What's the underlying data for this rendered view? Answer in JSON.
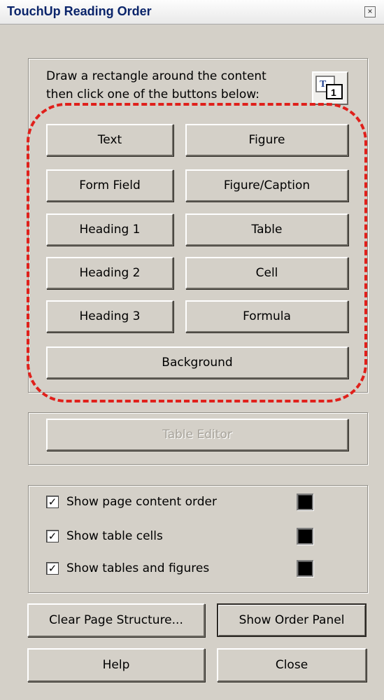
{
  "window": {
    "title": "TouchUp Reading Order",
    "close_symbol": "×"
  },
  "instructions": {
    "line1": "Draw a rectangle around the content",
    "line2": "then click one of the buttons below:"
  },
  "tag_buttons": {
    "text": "Text",
    "figure": "Figure",
    "form_field": "Form Field",
    "figure_caption": "Figure/Caption",
    "heading1": "Heading 1",
    "table": "Table",
    "heading2": "Heading 2",
    "cell": "Cell",
    "heading3": "Heading 3",
    "formula": "Formula",
    "background": "Background"
  },
  "table_editor": {
    "label": "Table Editor",
    "enabled": false
  },
  "options": [
    {
      "label": "Show page content order",
      "checked": true,
      "color": "#000000"
    },
    {
      "label": "Show table cells",
      "checked": true,
      "color": "#000000"
    },
    {
      "label": "Show tables and figures",
      "checked": true,
      "color": "#000000"
    }
  ],
  "check_mark": "✓",
  "actions": {
    "clear_page_structure": "Clear Page Structure...",
    "show_order_panel": "Show Order Panel",
    "help": "Help",
    "close": "Close"
  },
  "icons": {
    "order_icon": "order-icon",
    "close_icon": "close-icon"
  },
  "colors": {
    "dialog_bg": "#d4d0c8",
    "title_text": "#0a246a",
    "highlight_dash": "#e0201b",
    "disabled_text": "#a7a39b"
  }
}
